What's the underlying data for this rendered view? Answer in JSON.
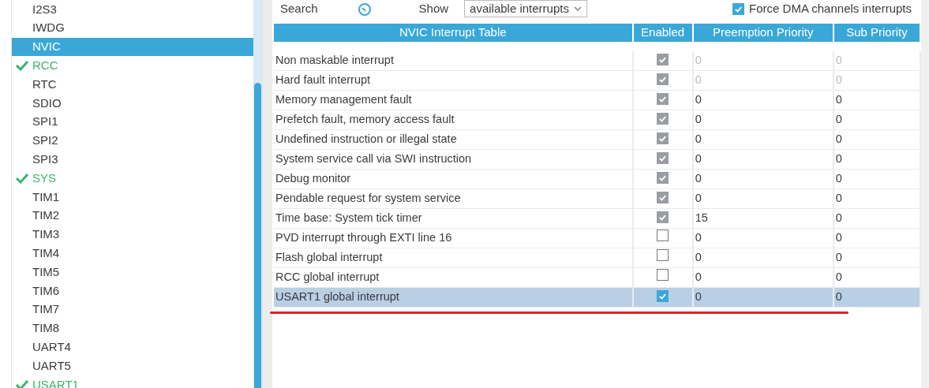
{
  "sidebar": {
    "items": [
      {
        "label": "I2S3",
        "checked": false,
        "selected": false
      },
      {
        "label": "IWDG",
        "checked": false,
        "selected": false
      },
      {
        "label": "NVIC",
        "checked": false,
        "selected": true
      },
      {
        "label": "RCC",
        "checked": true,
        "selected": false
      },
      {
        "label": "RTC",
        "checked": false,
        "selected": false
      },
      {
        "label": "SDIO",
        "checked": false,
        "selected": false
      },
      {
        "label": "SPI1",
        "checked": false,
        "selected": false
      },
      {
        "label": "SPI2",
        "checked": false,
        "selected": false
      },
      {
        "label": "SPI3",
        "checked": false,
        "selected": false
      },
      {
        "label": "SYS",
        "checked": true,
        "selected": false
      },
      {
        "label": "TIM1",
        "checked": false,
        "selected": false
      },
      {
        "label": "TIM2",
        "checked": false,
        "selected": false
      },
      {
        "label": "TIM3",
        "checked": false,
        "selected": false
      },
      {
        "label": "TIM4",
        "checked": false,
        "selected": false
      },
      {
        "label": "TIM5",
        "checked": false,
        "selected": false
      },
      {
        "label": "TIM6",
        "checked": false,
        "selected": false
      },
      {
        "label": "TIM7",
        "checked": false,
        "selected": false
      },
      {
        "label": "TIM8",
        "checked": false,
        "selected": false
      },
      {
        "label": "UART4",
        "checked": false,
        "selected": false
      },
      {
        "label": "UART5",
        "checked": false,
        "selected": false
      },
      {
        "label": "USART1",
        "checked": true,
        "selected": false
      }
    ]
  },
  "toolbar": {
    "search_label": "Search",
    "show_label": "Show",
    "show_value": "available interrupts",
    "force_dma": {
      "label": "Force DMA channels interrupts",
      "checked": true
    }
  },
  "table": {
    "columns": [
      "NVIC Interrupt Table",
      "Enabled",
      "Preemption Priority",
      "Sub Priority"
    ],
    "rows": [
      {
        "name": "Non maskable interrupt",
        "enabled": true,
        "enabled_locked": true,
        "priority_locked": true,
        "preemption": "0",
        "sub": "0",
        "selected": false
      },
      {
        "name": "Hard fault interrupt",
        "enabled": true,
        "enabled_locked": true,
        "priority_locked": true,
        "preemption": "0",
        "sub": "0",
        "selected": false
      },
      {
        "name": "Memory management fault",
        "enabled": true,
        "enabled_locked": true,
        "priority_locked": false,
        "preemption": "0",
        "sub": "0",
        "selected": false
      },
      {
        "name": "Prefetch fault, memory access fault",
        "enabled": true,
        "enabled_locked": true,
        "priority_locked": false,
        "preemption": "0",
        "sub": "0",
        "selected": false
      },
      {
        "name": "Undefined instruction or illegal state",
        "enabled": true,
        "enabled_locked": true,
        "priority_locked": false,
        "preemption": "0",
        "sub": "0",
        "selected": false
      },
      {
        "name": "System service call via SWI instruction",
        "enabled": true,
        "enabled_locked": true,
        "priority_locked": false,
        "preemption": "0",
        "sub": "0",
        "selected": false
      },
      {
        "name": "Debug monitor",
        "enabled": true,
        "enabled_locked": true,
        "priority_locked": false,
        "preemption": "0",
        "sub": "0",
        "selected": false
      },
      {
        "name": "Pendable request for system service",
        "enabled": true,
        "enabled_locked": true,
        "priority_locked": false,
        "preemption": "0",
        "sub": "0",
        "selected": false
      },
      {
        "name": "Time base: System tick timer",
        "enabled": true,
        "enabled_locked": true,
        "priority_locked": false,
        "preemption": "15",
        "sub": "0",
        "selected": false
      },
      {
        "name": "PVD interrupt through EXTI line 16",
        "enabled": false,
        "enabled_locked": false,
        "priority_locked": false,
        "preemption": "0",
        "sub": "0",
        "selected": false
      },
      {
        "name": "Flash global interrupt",
        "enabled": false,
        "enabled_locked": false,
        "priority_locked": false,
        "preemption": "0",
        "sub": "0",
        "selected": false
      },
      {
        "name": "RCC global interrupt",
        "enabled": false,
        "enabled_locked": false,
        "priority_locked": false,
        "preemption": "0",
        "sub": "0",
        "selected": false
      },
      {
        "name": "USART1 global interrupt",
        "enabled": true,
        "enabled_locked": false,
        "priority_locked": false,
        "preemption": "0",
        "sub": "0",
        "selected": true
      }
    ]
  }
}
